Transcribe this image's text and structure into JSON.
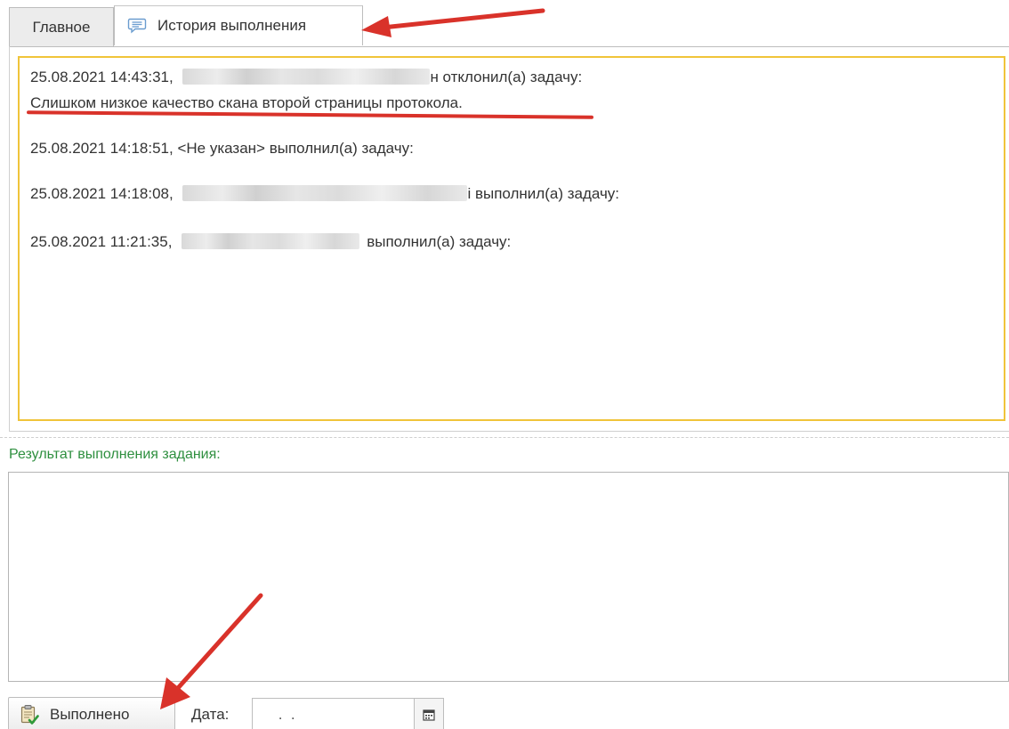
{
  "tabs": {
    "main_label": "Главное",
    "history_label": "История выполнения",
    "history_icon": "comment-icon"
  },
  "history": {
    "entries": [
      {
        "timestamp": "25.08.2021 14:43:31,",
        "user_tail": "н",
        "action": " отклонил(а) задачу:",
        "comment": "Слишком низкое качество скана второй страницы протокола."
      },
      {
        "timestamp": "25.08.2021 14:18:51,",
        "user": "<Не указан>",
        "action": "выполнил(а) задачу:"
      },
      {
        "timestamp": "25.08.2021 14:18:08,",
        "user_tail": "і",
        "action": " выполнил(а) задачу:"
      },
      {
        "timestamp": "25.08.2021 11:21:35,",
        "action": "выполнил(а) задачу:"
      }
    ]
  },
  "result": {
    "label": "Результат выполнения задания:",
    "value": ""
  },
  "footer": {
    "done_label": "Выполнено",
    "done_icon": "clipboard-check-icon",
    "date_label": "Дата:",
    "date_value": " .  .",
    "calendar_icon": "calendar-icon"
  },
  "colors": {
    "highlight_border": "#f0c43a",
    "annotation_red": "#d9322a",
    "result_label": "#2e8f3f"
  }
}
